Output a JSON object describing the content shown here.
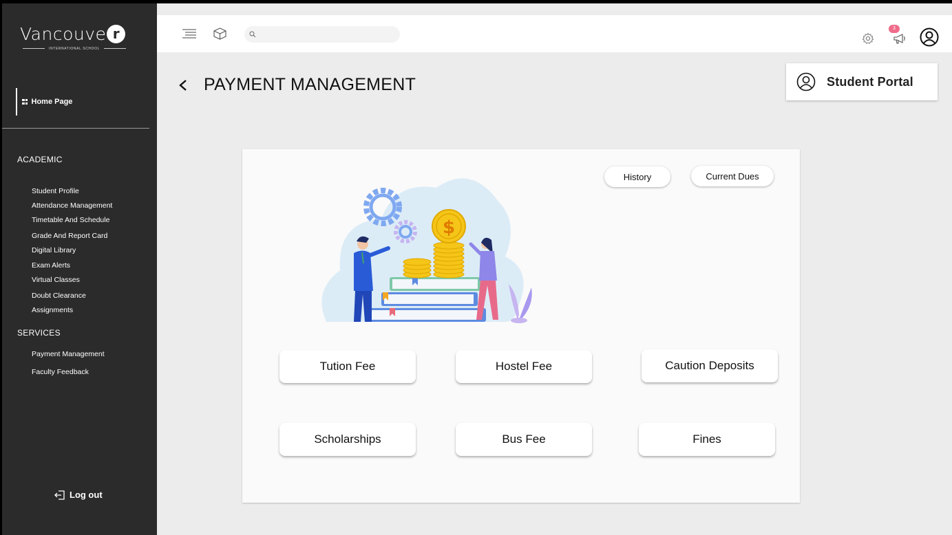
{
  "app": {
    "logo_main": "Vancouve",
    "logo_r": "r",
    "logo_sub": "INTERNATIONAL SCHOOL"
  },
  "sidebar": {
    "home": "Home Page",
    "academic_title": "ACADEMIC",
    "academic_items": [
      "Student Profile",
      "Attendance Management",
      "Timetable And Schedule",
      "Grade And Report Card",
      "Digital Library",
      "Exam Alerts",
      "Virtual Classes",
      "Doubt Clearance",
      "Assignments"
    ],
    "services_title": "SERVICES",
    "services_items": [
      "Payment Management",
      "Faculty Feedback"
    ],
    "logout": "Log out"
  },
  "topbar": {
    "search_placeholder": "",
    "notification_count": "3"
  },
  "portal": {
    "label": "Student Portal"
  },
  "page": {
    "title": "PAYMENT MANAGEMENT"
  },
  "panel": {
    "history_label": "History",
    "current_dues_label": "Current Dues",
    "fees": [
      "Tution Fee",
      "Hostel Fee",
      "Caution Deposits",
      "Scholarships",
      "Bus Fee",
      "Fines"
    ]
  },
  "colors": {
    "sidebar_bg": "#2b2b2b",
    "content_bg": "#ececec",
    "badge": "#f06b8a",
    "coin": "#f5c518"
  }
}
